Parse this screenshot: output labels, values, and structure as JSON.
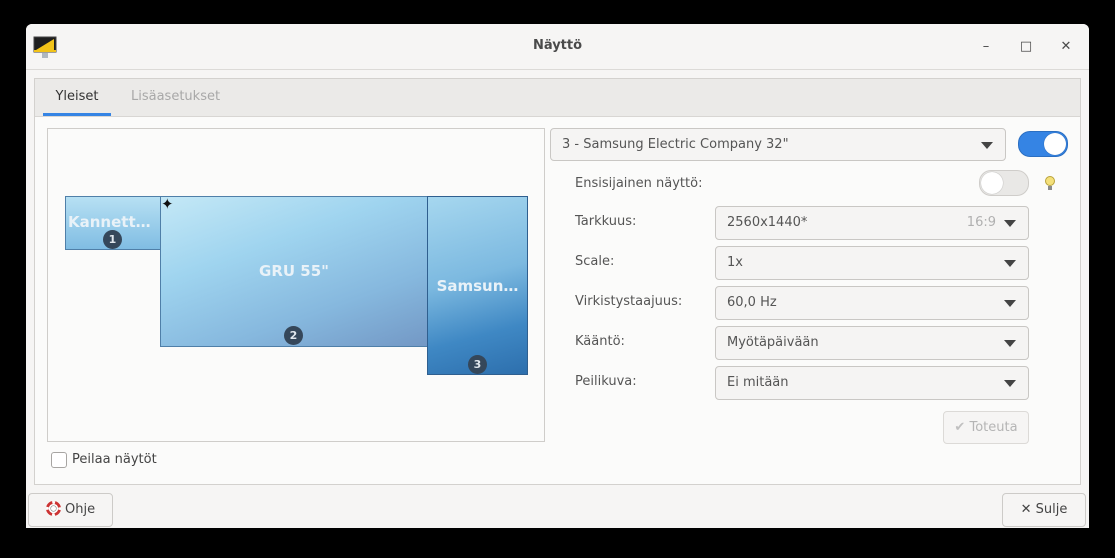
{
  "window": {
    "title": "Näyttö"
  },
  "titlebar": {
    "minimize": "–",
    "maximize": "□",
    "close": "✕"
  },
  "tabs": [
    {
      "label": "Yleiset",
      "active": true
    },
    {
      "label": "Lisäasetukset",
      "active": false
    }
  ],
  "arrangement": {
    "monitors": [
      {
        "label": "Kannett…",
        "number": "1"
      },
      {
        "label": "GRU 55\"",
        "number": "2",
        "primary": true
      },
      {
        "label": "Samsun…",
        "number": "3"
      }
    ]
  },
  "mirror": {
    "label": "Peilaa näytöt",
    "checked": false
  },
  "display_select": {
    "value": "3 - Samsung Electric Company 32\"",
    "enabled": true
  },
  "settings": {
    "primary": {
      "label": "Ensisijainen näyttö:",
      "on": false
    },
    "resolution": {
      "label": "Tarkkuus:",
      "value": "2560x1440*",
      "ratio": "16:9"
    },
    "scale": {
      "label": "Scale:",
      "value": "1x"
    },
    "refresh": {
      "label": "Virkistystaajuus:",
      "value": "60,0 Hz"
    },
    "rotation": {
      "label": "Kääntö:",
      "value": "Myötäpäivään"
    },
    "reflection": {
      "label": "Peilikuva:",
      "value": "Ei mitään"
    }
  },
  "apply_button": {
    "label": "Toteuta",
    "enabled": false
  },
  "footer": {
    "help_label": "Ohje",
    "close_label": "Sulje"
  },
  "colors": {
    "accent": "#3584e4",
    "monitor_light": "#a9d8ef",
    "monitor_dark": "#2d6fad"
  },
  "icons": [
    "display-settings-app-icon",
    "star-icon",
    "bulb-icon",
    "checkmark-icon",
    "help-lifebuoy-icon",
    "close-x-icon"
  ]
}
